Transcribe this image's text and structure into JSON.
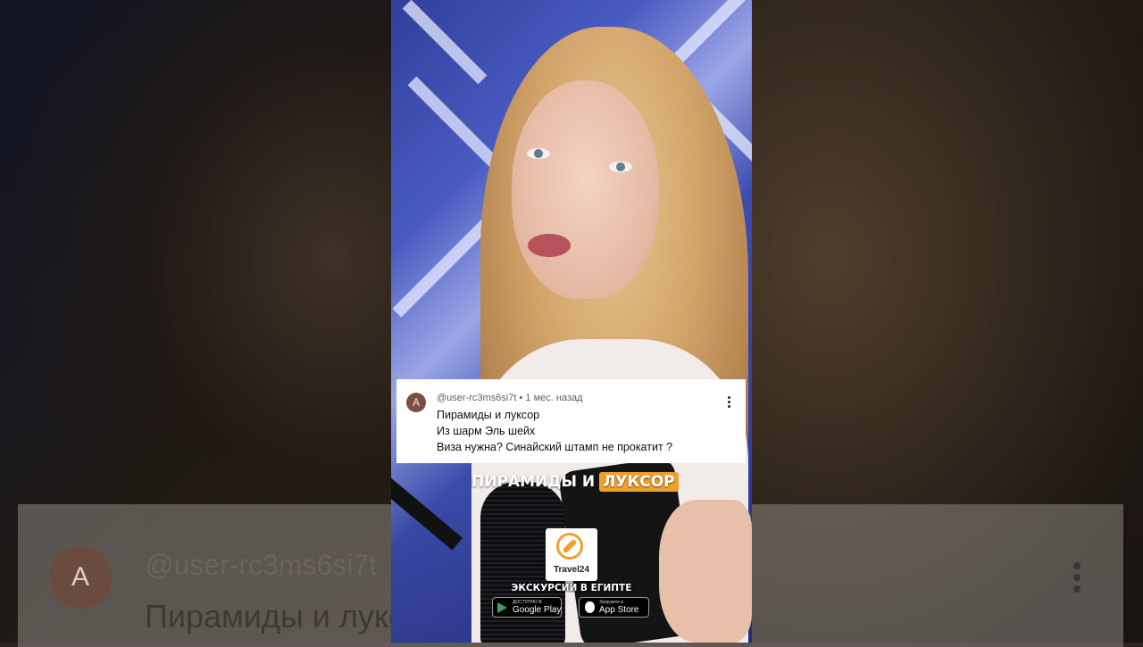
{
  "comment": {
    "avatar_letter": "A",
    "username": "@user-rc3ms6si7t",
    "separator": "•",
    "time_ago": "1 мес. назад",
    "lines": [
      "Пирамиды и луксор",
      "Из шарм Эль шейх",
      "Виза нужна? Синайский штамп не прокатит ?"
    ]
  },
  "caption": {
    "part1": "ПИРАМИДЫ И",
    "highlight": "ЛУКСОР",
    "highlight_color": "#f0a12b"
  },
  "promo": {
    "brand": "Travel24",
    "title": "ЭКСКУРСИИ В ЕГИПТЕ",
    "google_play": {
      "small": "ДОСТУПНО В",
      "big": "Google Play"
    },
    "app_store": {
      "small": "Загрузите в",
      "big": "App Store"
    }
  },
  "background_overlay": {
    "avatar_letter": "A",
    "username": "@user-rc3ms6si7t",
    "line1": "Пирамиды и луксор"
  }
}
